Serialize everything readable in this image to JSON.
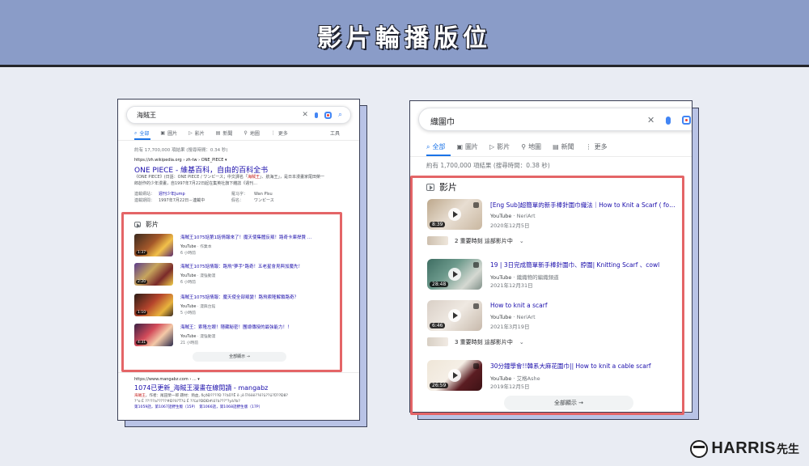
{
  "banner": {
    "title": "影片輪播版位"
  },
  "left": {
    "query": "海賊王",
    "tabs": [
      {
        "icon": "search-icon",
        "glyph": "⌕",
        "label": "全部",
        "active": true
      },
      {
        "icon": "image-icon",
        "glyph": "▣",
        "label": "圖片",
        "active": false
      },
      {
        "icon": "video-icon",
        "glyph": "▷",
        "label": "影片",
        "active": false
      },
      {
        "icon": "news-icon",
        "glyph": "▤",
        "label": "新聞",
        "active": false
      },
      {
        "icon": "map-icon",
        "glyph": "⚲",
        "label": "地圖",
        "active": false
      },
      {
        "icon": "more-icon",
        "glyph": "⋮",
        "label": "更多",
        "active": false
      }
    ],
    "tools_label": "工具",
    "stats": "約有 17,700,000 項結果 (搜尋時間：0.34 秒)",
    "wiki": {
      "url": "https://zh.wikipedia.org › zh-tw › ONE_PIECE  ▾",
      "title": "ONE PIECE - 維基百科，自由的百科全书",
      "text_pre": "《ONE PIECE》(日語：ONE PIECE / ワンピース；中文譯名「",
      "text_hl": "海賊王",
      "text_post": "」、航海王」，是日本漫畫家尾田榮一郎創作的少年漫畫，自1997年7月22日起在集英社旗下雜誌《週刊…",
      "facts": [
        {
          "k": "連載網站：",
          "v": "週刊少年Jump",
          "k2": "羅马字：",
          "v2": "Wan Pīsu"
        },
        {
          "k": "連載期間：",
          "v": "1997年7月22日－連載中",
          "k2": "假名：",
          "v2": "ワンピース"
        }
      ]
    },
    "videos_heading": "影片",
    "videos": [
      {
        "title": "海賊王1075話第1話情報來了！魔天使集體反叛！路奇卡庫捍贊 …",
        "source": "YouTube",
        "channel": "作業本",
        "date": "6 小時前",
        "duration": "1:37"
      },
      {
        "title": "海賊王1075話情報：路飛\"夢手\"路奇！五老星會見與加魔先！",
        "source": "YouTube",
        "channel": "漫強動漫",
        "date": "6 小時前",
        "duration": "2:20"
      },
      {
        "title": "海賊王1075話情報：魔天使全部叛變！路飛索隆解鎖路奇？",
        "source": "YouTube",
        "channel": "漫興台館",
        "date": "5 小時前",
        "duration": "1:10"
      },
      {
        "title": "海賊王：索隆左眼！隱藏秘密！團總傳授的最強能力！！",
        "source": "YouTube",
        "channel": "漫強動漫",
        "date": "21 小時前",
        "duration": "4:31"
      }
    ],
    "show_all": "全部顯示  →",
    "next": {
      "url": "https://www.mangabz.com › ...  ▾",
      "title": "1074已更新_海賊王漫畫在線閱讀 - mangabz",
      "line1_hl": "海賊王",
      "line1": "，作者：尾田榮一郎 題材：熱血, δçðÐ????Ð ??àÜ?Ë ë ¡ë Ï?ëëë??ë?ü??ü?Ü??Ð8?",
      "line2": "?°o É ??!??a?????#Ð?ë?T?ü É ??üz?ÐÐÐ#iö?à???\"?yà?b?",
      "line3": "第1059話，第1067話野生版（15P）　第1066話，第1068話野生版（17P）"
    }
  },
  "right": {
    "query": "織圍巾",
    "tabs": [
      {
        "icon": "search-icon",
        "glyph": "⌕",
        "label": "全部",
        "active": true
      },
      {
        "icon": "image-icon",
        "glyph": "▣",
        "label": "圖片",
        "active": false
      },
      {
        "icon": "video-icon",
        "glyph": "▷",
        "label": "影片",
        "active": false
      },
      {
        "icon": "map-icon",
        "glyph": "⚲",
        "label": "地圖",
        "active": false
      },
      {
        "icon": "news-icon",
        "glyph": "▤",
        "label": "新聞",
        "active": false
      },
      {
        "icon": "more-icon",
        "glyph": "⋮",
        "label": "更多",
        "active": false
      }
    ],
    "stats": "約有 1,700,000 項結果 (搜尋時間：0.38 秒)",
    "videos_heading": "影片",
    "videos": [
      {
        "title": "[Eng Sub]超簡單的新手棒針圍巾織法｜How to Knit a Scarf ( fo…",
        "source": "YouTube",
        "channel": "NeriArt",
        "date": "2020年12月5日",
        "duration": "8:39"
      },
      {
        "title": "19 | 3日完成簡單新手棒針圍巾、脖圍| Knitting Scarf 、cowl",
        "source": "YouTube",
        "channel": "織織物的編織頻道",
        "date": "2021年12月31日",
        "duration": "28:48"
      },
      {
        "title": "How to knit a scarf",
        "source": "YouTube",
        "channel": "NeriArt",
        "date": "2021年3月19日",
        "duration": "6:46"
      },
      {
        "title": "30分鐘學會!!韓系大麻花圍巾|| How to knit a cable scarf",
        "source": "YouTube",
        "channel": "艾格Ashe",
        "date": "2019年12月5日",
        "duration": "26:59"
      }
    ],
    "key_moments_label": "2 重要時刻 這部影片中",
    "key_moments_label_2": "3 重要時刻 這部影片中",
    "show_all": "全部顯示  →"
  },
  "logo": {
    "text": "HARRIS",
    "suffix": "先生"
  }
}
